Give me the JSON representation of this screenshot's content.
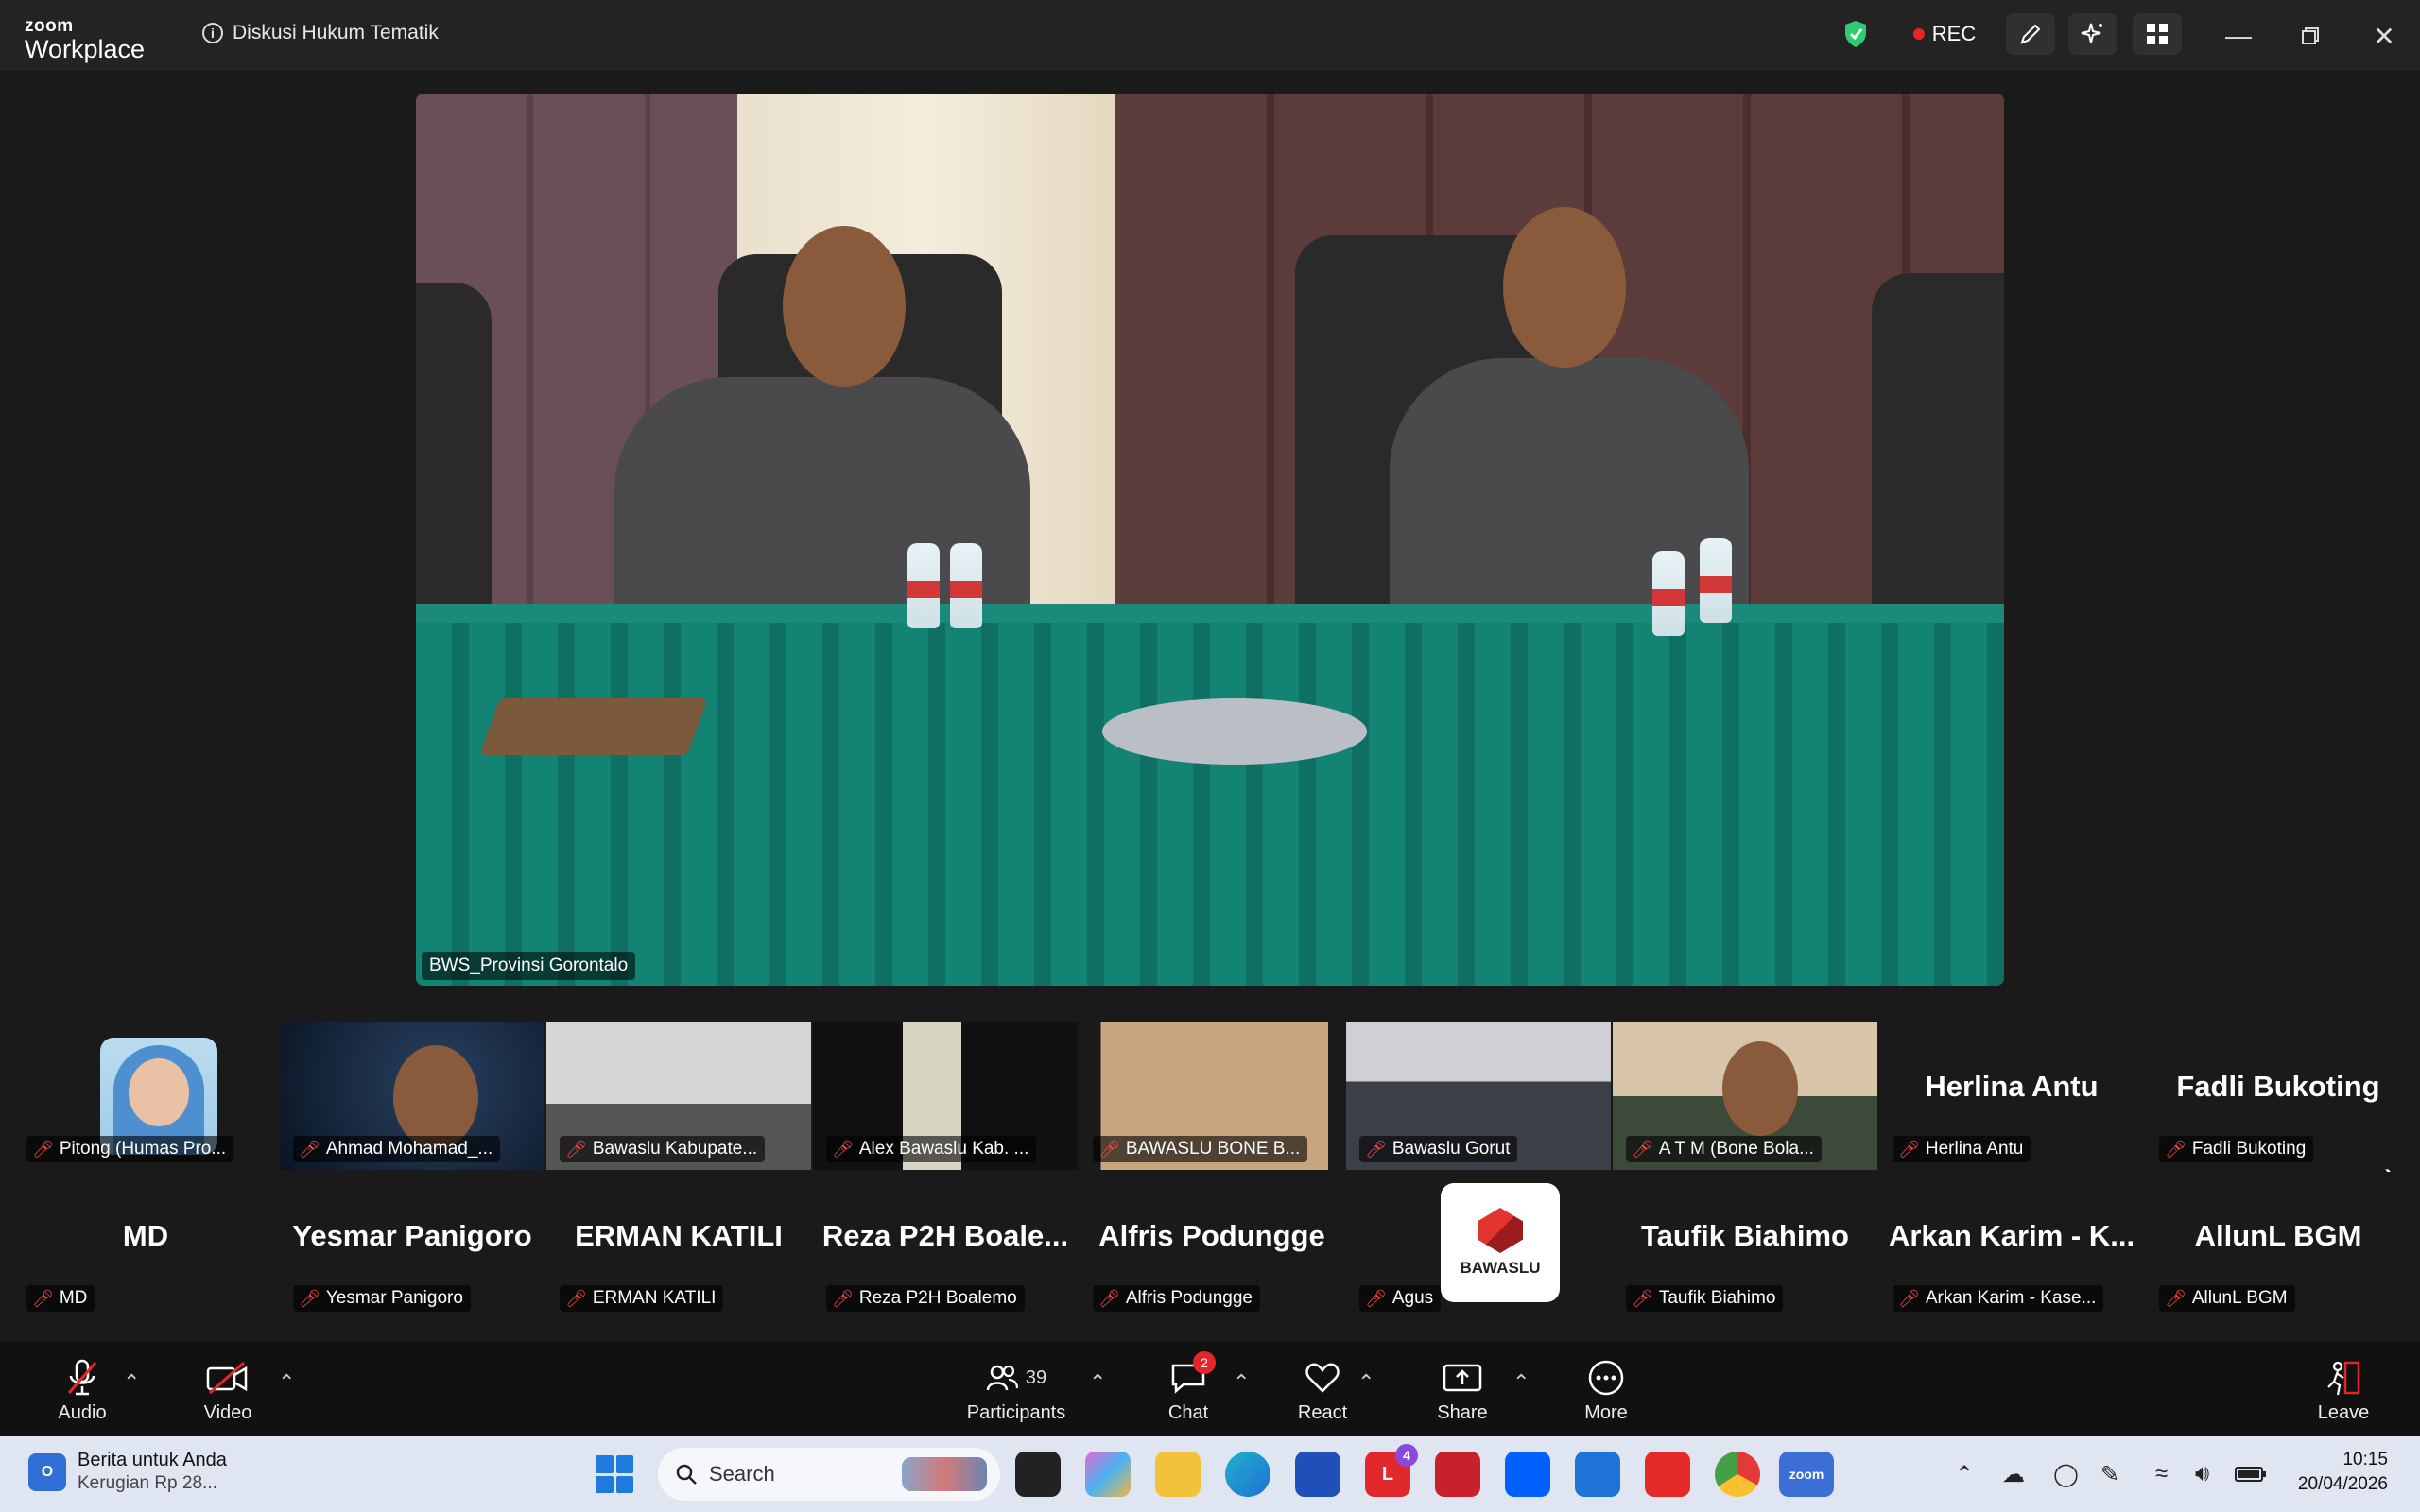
{
  "titlebar": {
    "brand_top": "zoom",
    "brand_bottom": "Workplace",
    "meeting_title": "Diskusi Hukum Tematik",
    "rec_label": "REC",
    "icons": [
      "shield-check-icon",
      "pen-icon",
      "sparkle-icon",
      "apps-icon",
      "minimize-icon",
      "restore-icon",
      "close-icon"
    ]
  },
  "main_video": {
    "label": "BWS_Provinsi Gorontalo"
  },
  "gallery": {
    "row1": [
      {
        "label": "Pitong (Humas Pro..."
      },
      {
        "label": "Ahmad Mohamad_..."
      },
      {
        "label": "Bawaslu Kabupate..."
      },
      {
        "label": "Alex Bawaslu Kab. ..."
      },
      {
        "label": "BAWASLU BONE B..."
      },
      {
        "label": "Bawaslu Gorut"
      },
      {
        "label": "A T M  (Bone Bola..."
      },
      {
        "name": "Herlina Antu",
        "label": "Herlina Antu"
      },
      {
        "name": "Fadli Bukoting",
        "label": "Fadli Bukoting"
      }
    ],
    "row2": [
      {
        "name": "MD",
        "label": "MD"
      },
      {
        "name": "Yesmar Panigoro",
        "label": "Yesmar Panigoro"
      },
      {
        "name": "ERMAN KATILI",
        "label": "ERMAN KATILI"
      },
      {
        "name": "Reza  P2H  Boale...",
        "label": "Reza P2H Boalemo"
      },
      {
        "name": "Alfris Podungge",
        "label": "Alfris Podungge"
      },
      {
        "logo_text": "BAWASLU",
        "label": "Agus"
      },
      {
        "name": "Taufik Biahimo",
        "label": "Taufik Biahimo"
      },
      {
        "name": "Arkan Karim - K...",
        "label": "Arkan Karim - Kase..."
      },
      {
        "name": "AllunL BGM",
        "label": "AllunL BGM"
      }
    ]
  },
  "toolbar": {
    "audio": "Audio",
    "video": "Video",
    "participants": "Participants",
    "participants_count": "39",
    "chat": "Chat",
    "chat_badge": "2",
    "react": "React",
    "share": "Share",
    "more": "More",
    "leave": "Leave"
  },
  "taskbar": {
    "news_title": "Berita untuk Anda",
    "news_sub": "Kerugian Rp 28...",
    "search_label": "Search",
    "red_app_badge": "4",
    "time": "10:15",
    "date": "20/04/2026"
  }
}
